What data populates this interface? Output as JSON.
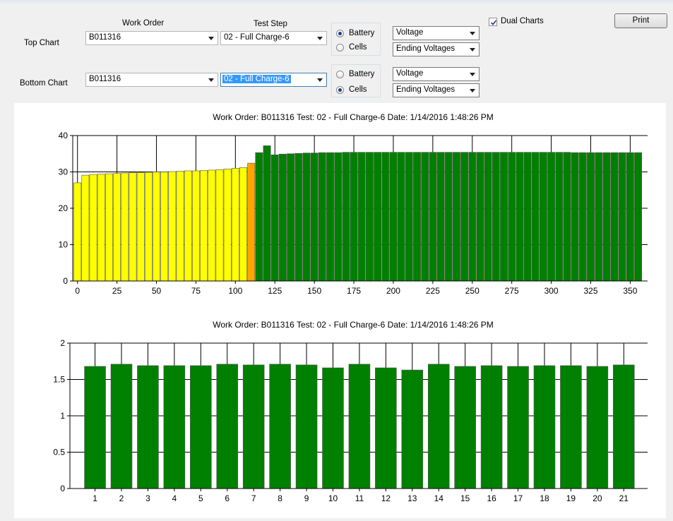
{
  "controls": {
    "work_order_header": "Work Order",
    "test_step_header": "Test Step",
    "dual_charts_label": "Dual Charts",
    "dual_charts_checked": true,
    "print_label": "Print",
    "top": {
      "row_label": "Top Chart",
      "work_order": "B011316",
      "test_step": "02 - Full Charge-6",
      "radio_battery": "Battery",
      "radio_cells": "Cells",
      "selected": "Battery",
      "measure": "Voltage",
      "view": "Ending Voltages"
    },
    "bottom": {
      "row_label": "Bottom Chart",
      "work_order": "B011316",
      "test_step": "02 - Full Charge-6",
      "radio_battery": "Battery",
      "radio_cells": "Cells",
      "selected": "Cells",
      "measure": "Voltage",
      "view": "Ending Voltages"
    }
  },
  "chart_data": [
    {
      "type": "bar",
      "title": "Work Order:  B011316    Test:  02 - Full Charge-6    Date:  1/14/2016 1:48:26 PM",
      "xlabel": "",
      "ylabel": "",
      "ylim": [
        0,
        40
      ],
      "yticks": [
        "0",
        "10",
        "20",
        "30",
        "40"
      ],
      "xticks": [
        "0",
        "25",
        "50",
        "75",
        "100",
        "125",
        "150",
        "175",
        "200",
        "225",
        "250",
        "275",
        "300",
        "325",
        "350"
      ],
      "xrange": [
        -3,
        361
      ],
      "bar_width": 4.6,
      "grid": true,
      "colors": {
        "yellow": "#ffff00",
        "orange": "#ffa500",
        "green": "#008000"
      },
      "series": [
        {
          "color": "yellow",
          "x": [
            0,
            5,
            10,
            15,
            20,
            25,
            30,
            35,
            40,
            45,
            50,
            55,
            60,
            65,
            70,
            75,
            80,
            85,
            90,
            95,
            100,
            105
          ],
          "values": [
            27,
            29.1,
            29.3,
            29.4,
            29.5,
            29.6,
            29.7,
            29.8,
            29.8,
            29.9,
            30,
            30,
            30.1,
            30.2,
            30.3,
            30.3,
            30.4,
            30.5,
            30.6,
            30.8,
            31,
            31.2
          ]
        },
        {
          "color": "orange",
          "x": [
            110
          ],
          "values": [
            32.4
          ]
        },
        {
          "color": "green",
          "x": [
            115,
            120,
            125,
            130,
            135,
            140,
            145,
            150,
            155,
            160,
            165,
            170,
            175,
            180,
            185,
            190,
            195,
            200,
            205,
            210,
            215,
            220,
            225,
            230,
            235,
            240,
            245,
            250,
            255,
            260,
            265,
            270,
            275,
            280,
            285,
            290,
            295,
            300,
            305,
            310,
            315,
            320,
            325,
            330,
            335,
            340,
            345,
            350,
            355
          ],
          "values": [
            35.3,
            37.2,
            34.7,
            34.9,
            35,
            35.1,
            35.2,
            35.2,
            35.3,
            35.3,
            35.3,
            35.4,
            35.4,
            35.4,
            35.4,
            35.4,
            35.4,
            35.4,
            35.4,
            35.4,
            35.4,
            35.4,
            35.4,
            35.4,
            35.4,
            35.4,
            35.4,
            35.4,
            35.4,
            35.4,
            35.4,
            35.4,
            35.4,
            35.4,
            35.4,
            35.4,
            35.4,
            35.4,
            35.4,
            35.4,
            35.3,
            35.3,
            35.3,
            35.3,
            35.3,
            35.3,
            35.3,
            35.3,
            35.3
          ]
        }
      ]
    },
    {
      "type": "bar",
      "title": "Work Order:  B011316    Test:  02 - Full Charge-6    Date:  1/14/2016 1:48:26 PM",
      "xlabel": "",
      "ylabel": "",
      "ylim": [
        0,
        2
      ],
      "yticks": [
        "0",
        "0.5",
        "1",
        "1.5",
        "2"
      ],
      "categories": [
        "1",
        "2",
        "3",
        "4",
        "5",
        "6",
        "7",
        "8",
        "9",
        "10",
        "11",
        "12",
        "13",
        "14",
        "15",
        "16",
        "17",
        "18",
        "19",
        "20",
        "21"
      ],
      "grid": true,
      "colors": {
        "green": "#008000"
      },
      "values": [
        1.68,
        1.71,
        1.69,
        1.69,
        1.69,
        1.71,
        1.7,
        1.71,
        1.7,
        1.66,
        1.71,
        1.66,
        1.63,
        1.71,
        1.68,
        1.69,
        1.68,
        1.69,
        1.69,
        1.68,
        1.7
      ]
    }
  ]
}
